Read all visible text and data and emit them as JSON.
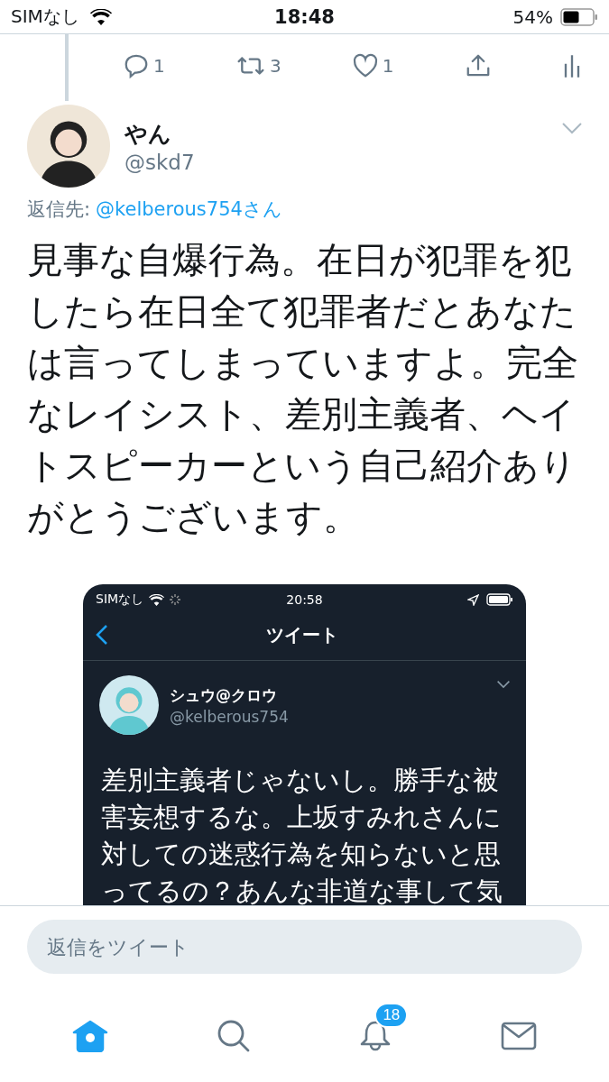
{
  "status_bar": {
    "carrier": "SIMなし",
    "time": "18:48",
    "battery": "54%"
  },
  "actions": [
    {
      "kind": "reply",
      "count": "1"
    },
    {
      "kind": "retweet",
      "count": "3"
    },
    {
      "kind": "like",
      "count": "1"
    },
    {
      "kind": "share"
    },
    {
      "kind": "stats"
    }
  ],
  "tweet": {
    "name": "やん",
    "handle": "@skd7",
    "reply_to_label": "返信先:",
    "reply_to_handle": "@kelberous754さん",
    "text": "見事な自爆行為。在日が犯罪を犯したら在日全て犯罪者だとあなたは言ってしまっていますよ。完全なレイシスト、差別主義者、ヘイトスピーカーという自己紹介ありがとうございます。",
    "embedded_screenshot": {
      "carrier": "SIMなし",
      "time": "20:58",
      "title": "ツイート",
      "name": "シュウ@クロウ",
      "handle": "@kelberous754",
      "text": "差別主義者じゃないし。勝手な被害妄想するな。上坂すみれさんに対しての迷惑行為を知らないと思ってるの？あんな非道な事して気"
    }
  },
  "reply_bar": {
    "placeholder": "返信をツイート"
  },
  "tab_bar": [
    {
      "kind": "home",
      "selected": true
    },
    {
      "kind": "search",
      "selected": false
    },
    {
      "kind": "notifications",
      "selected": false,
      "badge": "18"
    },
    {
      "kind": "messages",
      "selected": false
    }
  ]
}
